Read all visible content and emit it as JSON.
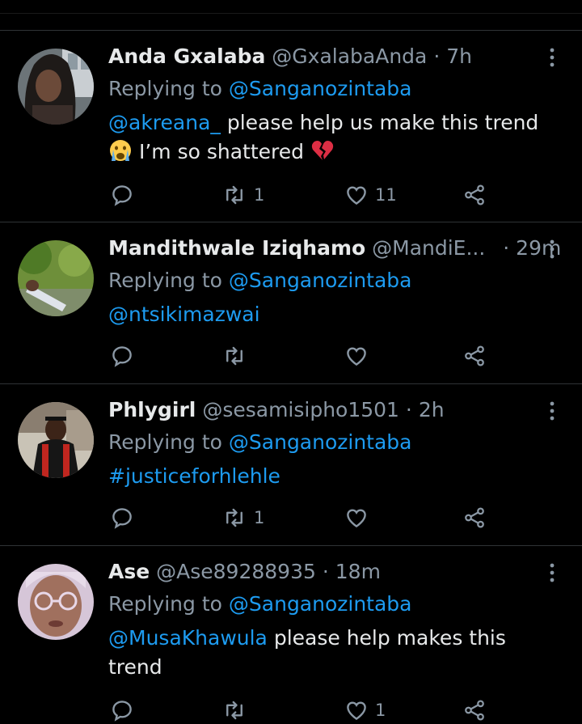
{
  "tweets": [
    {
      "name": "Anda Gxalaba",
      "handle": "@GxalabaAnda",
      "time": "7h",
      "replying_prefix": "Replying to",
      "replying_to": "@Sanganozintaba",
      "mention": "@akreana_",
      "text_line1": "  please help us make this trend",
      "text_line2": " I’m so  shattered ",
      "emoji1": "crying-face",
      "emoji2": "broken-heart",
      "retweets": "1",
      "likes": "11"
    },
    {
      "name": "Mandithwale Iziqhamo",
      "handle": "@MandiE...",
      "time": "29m",
      "replying_prefix": "Replying to",
      "replying_to": "@Sanganozintaba",
      "mention": "@ntsikimazwai",
      "retweets": "",
      "likes": ""
    },
    {
      "name": "Phlygirl",
      "handle": "@sesamisipho1501",
      "time": "2h",
      "replying_prefix": "Replying to",
      "replying_to": "@Sanganozintaba",
      "hashtag": "#justiceforhlehle",
      "retweets": "1",
      "likes": ""
    },
    {
      "name": "Ase",
      "handle": "@Ase89288935",
      "time": "18m",
      "replying_prefix": "Replying to",
      "replying_to": "@Sanganozintaba",
      "mention": "@MusaKhawula",
      "text_line1": " please help makes this",
      "text_line2": "trend",
      "retweets": "",
      "likes": "1"
    }
  ],
  "separator": "·",
  "colors": {
    "background": "#000000",
    "link": "#1d9bf0",
    "muted": "#8b98a5",
    "text": "#e7e9ea",
    "divider": "#2f3336"
  },
  "icons": [
    "reply-icon",
    "retweet-icon",
    "like-icon",
    "share-icon",
    "more-options-icon"
  ]
}
